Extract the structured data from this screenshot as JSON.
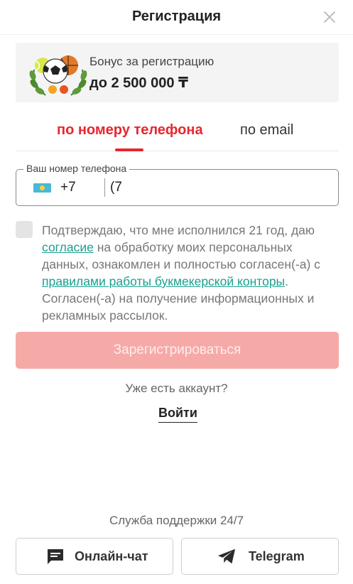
{
  "header": {
    "title": "Регистрация",
    "close_icon": "close-icon"
  },
  "bonus": {
    "label": "Бонус за регистрацию",
    "amount": "до 2 500 000 ₸",
    "image_icon": "sports-balls-laurel-icon"
  },
  "tabs": [
    {
      "label": "по номеру телефона",
      "active": true
    },
    {
      "label": "по email",
      "active": false
    }
  ],
  "phone": {
    "legend": "Ваш номер телефона",
    "country_flag": "kazakhstan-flag-icon",
    "country_code": "+7",
    "value": "(7",
    "placeholder": ""
  },
  "consent": {
    "checked": false,
    "text_1": "Подтверждаю, что мне исполнился 21 год, даю ",
    "link_1": "согласие",
    "text_2": " на обработку моих персональных данных, ознакомлен и полностью согласен(-а) с ",
    "link_2": "правилами работы букмекерской конторы",
    "text_3": ". Согласен(-а) на получение информационных и рекламных рассылок."
  },
  "register_button": "Зарегистрироваться",
  "have_account": "Уже есть аккаунт?",
  "login_link": "Войти",
  "support": {
    "label": "Служба поддержки 24/7",
    "chat_label": "Онлайн-чат",
    "chat_icon": "chat-message-icon",
    "telegram_label": "Telegram",
    "telegram_icon": "telegram-plane-icon"
  },
  "colors": {
    "accent": "#e8262d",
    "link": "#1aa08e",
    "button_disabled": "#f6aaa7"
  }
}
